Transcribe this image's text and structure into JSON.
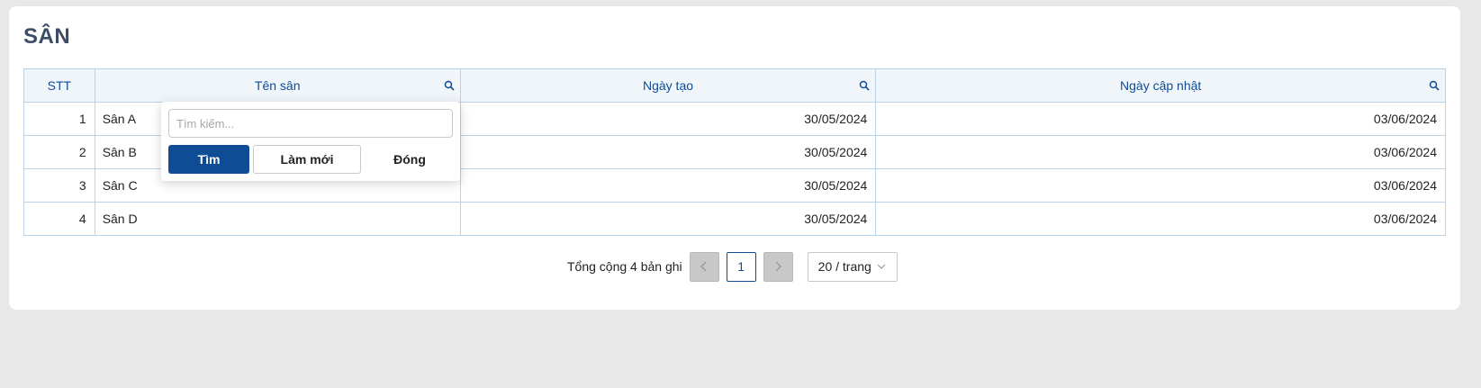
{
  "page": {
    "title": "SÂN"
  },
  "table": {
    "columns": [
      "STT",
      "Tên sân",
      "Ngày tạo",
      "Ngày cập nhật"
    ],
    "rows": [
      {
        "stt": "1",
        "name": "Sân A",
        "created": "30/05/2024",
        "updated": "03/06/2024"
      },
      {
        "stt": "2",
        "name": "Sân B",
        "created": "30/05/2024",
        "updated": "03/06/2024"
      },
      {
        "stt": "3",
        "name": "Sân C",
        "created": "30/05/2024",
        "updated": "03/06/2024"
      },
      {
        "stt": "4",
        "name": "Sân D",
        "created": "30/05/2024",
        "updated": "03/06/2024"
      }
    ]
  },
  "filter_popup": {
    "placeholder": "Tìm kiếm...",
    "search_label": "Tìm",
    "reset_label": "Làm mới",
    "close_label": "Đóng"
  },
  "pagination": {
    "total_text": "Tổng cộng 4 bản ghi",
    "current_page": "1",
    "page_size_label": "20 / trang"
  },
  "colors": {
    "accent": "#0f4c96",
    "header_bg": "#f0f5fa",
    "border": "#b9d3ea",
    "title": "#3d4d66"
  },
  "icons": {
    "column_search": "search-icon",
    "prev": "chevron-left-icon",
    "next": "chevron-right-icon",
    "dropdown": "chevron-down-icon"
  }
}
